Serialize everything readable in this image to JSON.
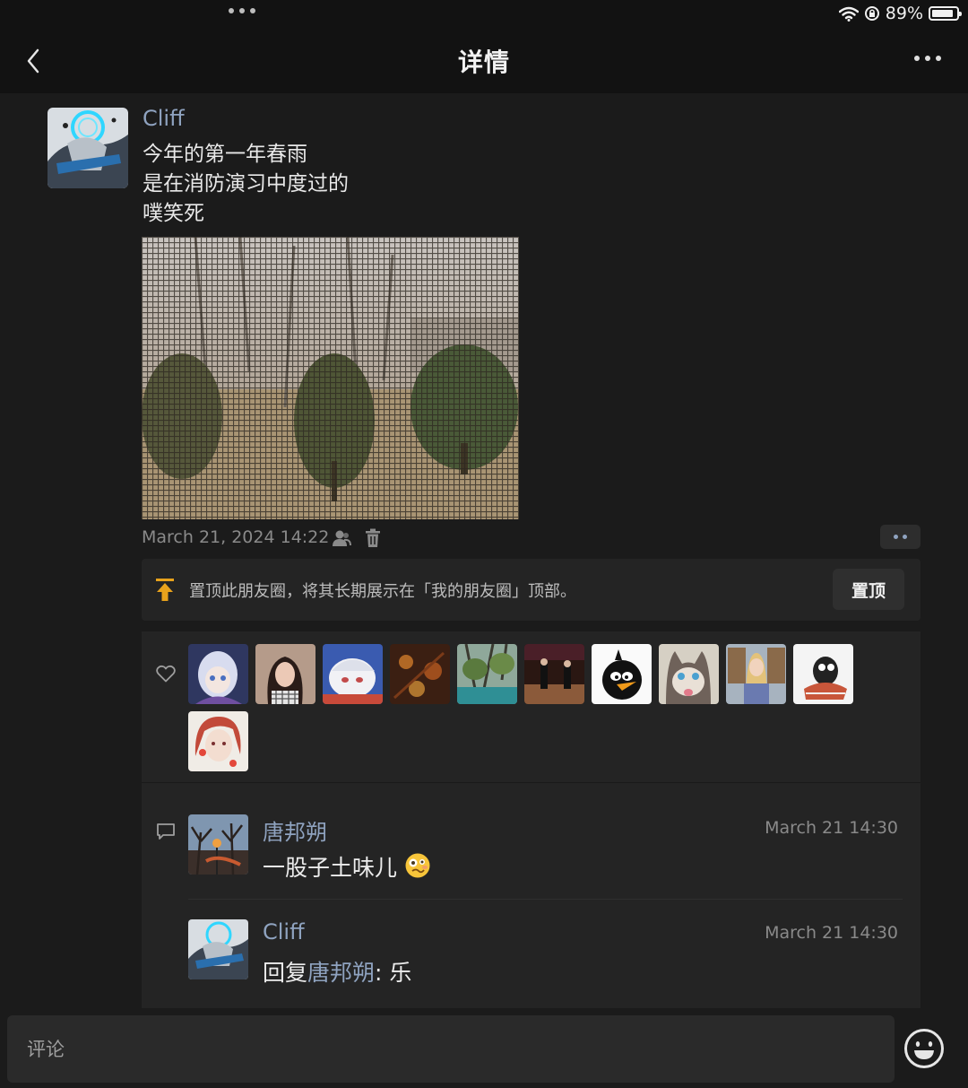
{
  "status_bar": {
    "battery": "89%",
    "battery_level": 0.89
  },
  "nav": {
    "title": "详情"
  },
  "post": {
    "author": "Cliff",
    "lines": [
      "今年的第一年春雨",
      "是在消防演习中度过的",
      "噗笑死"
    ],
    "time": "March 21, 2024 14:22"
  },
  "pin": {
    "text": "置顶此朋友圈，将其长期展示在「我的朋友圈」顶部。",
    "button": "置顶"
  },
  "likes": {
    "count": 11
  },
  "comments": [
    {
      "name": "唐邦朔",
      "time": "March 21 14:30",
      "text": "一股子土味儿"
    },
    {
      "name": "Cliff",
      "time": "March 21 14:30",
      "prefix": "回复",
      "reply_to": "唐邦朔",
      "text": ": 乐"
    }
  ],
  "input": {
    "placeholder": "评论"
  },
  "colors": {
    "link": "#8fa3c0",
    "background": "#1b1b1b",
    "card": "#242424",
    "pin_icon": "#e8a21c"
  }
}
